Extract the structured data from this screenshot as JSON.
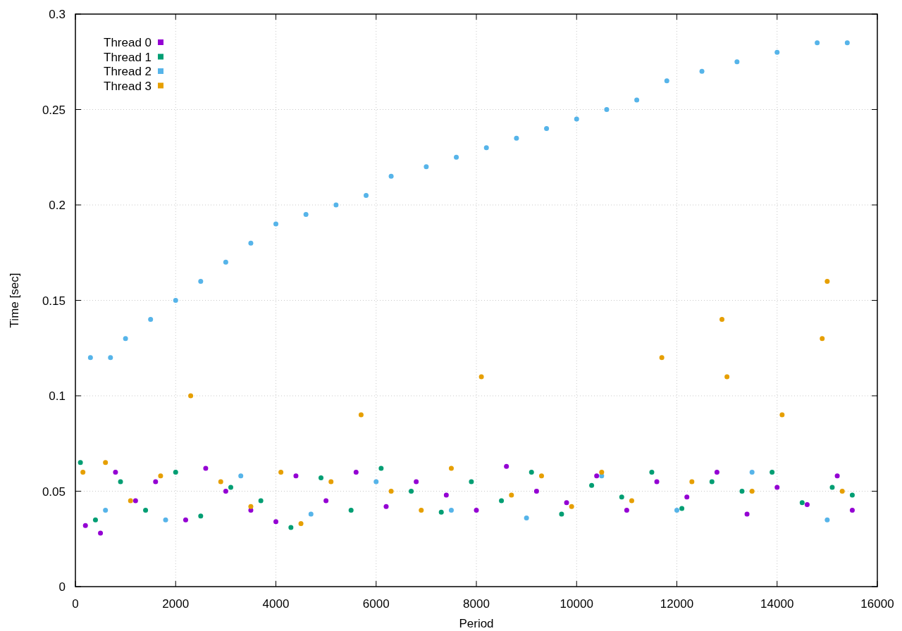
{
  "chart_data": {
    "type": "scatter",
    "grid": true,
    "legend": true,
    "xlabel": "Period",
    "ylabel": "Time [sec]",
    "xlim": [
      0,
      16000
    ],
    "ylim": [
      0,
      0.3
    ],
    "xticks": [
      0,
      2000,
      4000,
      6000,
      8000,
      10000,
      12000,
      14000,
      16000
    ],
    "yticks": [
      {
        "value": 0,
        "label": "0"
      },
      {
        "value": 0.05,
        "label": "0.05"
      },
      {
        "value": 0.1,
        "label": "0.1"
      },
      {
        "value": 0.15,
        "label": "0.15"
      },
      {
        "value": 0.2,
        "label": "0.2"
      },
      {
        "value": 0.25,
        "label": "0.25"
      },
      {
        "value": 0.3,
        "label": "0.3"
      }
    ],
    "series": [
      {
        "name": "Thread 0",
        "color": "#9400d3",
        "x": [
          200,
          500,
          800,
          1200,
          1600,
          2200,
          2600,
          3000,
          3500,
          4000,
          4400,
          5000,
          5600,
          6200,
          6800,
          7400,
          8000,
          8600,
          9200,
          9800,
          10400,
          11000,
          11600,
          12200,
          12800,
          13400,
          14000,
          14600,
          15200,
          15500
        ],
        "values": [
          0.032,
          0.028,
          0.06,
          0.045,
          0.055,
          0.035,
          0.062,
          0.05,
          0.04,
          0.034,
          0.058,
          0.045,
          0.06,
          0.042,
          0.055,
          0.048,
          0.04,
          0.063,
          0.05,
          0.044,
          0.058,
          0.04,
          0.055,
          0.047,
          0.06,
          0.038,
          0.052,
          0.043,
          0.058,
          0.04
        ]
      },
      {
        "name": "Thread 1",
        "color": "#009e73",
        "x": [
          100,
          400,
          900,
          1400,
          2000,
          2500,
          3100,
          3700,
          4300,
          4900,
          5500,
          6100,
          6700,
          7300,
          7900,
          8500,
          9100,
          9700,
          10300,
          10900,
          11500,
          12100,
          12700,
          13300,
          13900,
          14500,
          15100,
          15500
        ],
        "values": [
          0.065,
          0.035,
          0.055,
          0.04,
          0.06,
          0.037,
          0.052,
          0.045,
          0.031,
          0.057,
          0.04,
          0.062,
          0.05,
          0.039,
          0.055,
          0.045,
          0.06,
          0.038,
          0.053,
          0.047,
          0.06,
          0.041,
          0.055,
          0.05,
          0.06,
          0.044,
          0.052,
          0.048
        ]
      },
      {
        "name": "Thread 2",
        "color": "#56b4e9",
        "x": [
          300,
          700,
          1000,
          1500,
          2000,
          2500,
          3000,
          3500,
          4000,
          4600,
          5200,
          5800,
          6300,
          7000,
          7600,
          8200,
          8800,
          9400,
          10000,
          10600,
          11200,
          11800,
          12500,
          13200,
          14000,
          14800,
          15400,
          600,
          1800,
          3300,
          4700,
          6000,
          7500,
          9000,
          10500,
          12000,
          13500,
          15000
        ],
        "values": [
          0.12,
          0.12,
          0.13,
          0.14,
          0.15,
          0.16,
          0.17,
          0.18,
          0.19,
          0.195,
          0.2,
          0.205,
          0.215,
          0.22,
          0.225,
          0.23,
          0.235,
          0.24,
          0.245,
          0.25,
          0.255,
          0.265,
          0.27,
          0.275,
          0.28,
          0.285,
          0.285,
          0.04,
          0.035,
          0.058,
          0.038,
          0.055,
          0.04,
          0.036,
          0.058,
          0.04,
          0.06,
          0.035
        ]
      },
      {
        "name": "Thread 3",
        "color": "#e69f00",
        "x": [
          150,
          600,
          1100,
          1700,
          2300,
          2900,
          3500,
          4100,
          4500,
          5100,
          5700,
          6300,
          6900,
          7500,
          8100,
          8700,
          9300,
          9900,
          10500,
          11100,
          11700,
          12300,
          12900,
          13000,
          13500,
          14100,
          14900,
          15000,
          15300
        ],
        "values": [
          0.06,
          0.065,
          0.045,
          0.058,
          0.1,
          0.055,
          0.042,
          0.06,
          0.033,
          0.055,
          0.09,
          0.05,
          0.04,
          0.062,
          0.11,
          0.048,
          0.058,
          0.042,
          0.06,
          0.045,
          0.12,
          0.055,
          0.14,
          0.11,
          0.05,
          0.09,
          0.13,
          0.16,
          0.05
        ]
      }
    ]
  }
}
